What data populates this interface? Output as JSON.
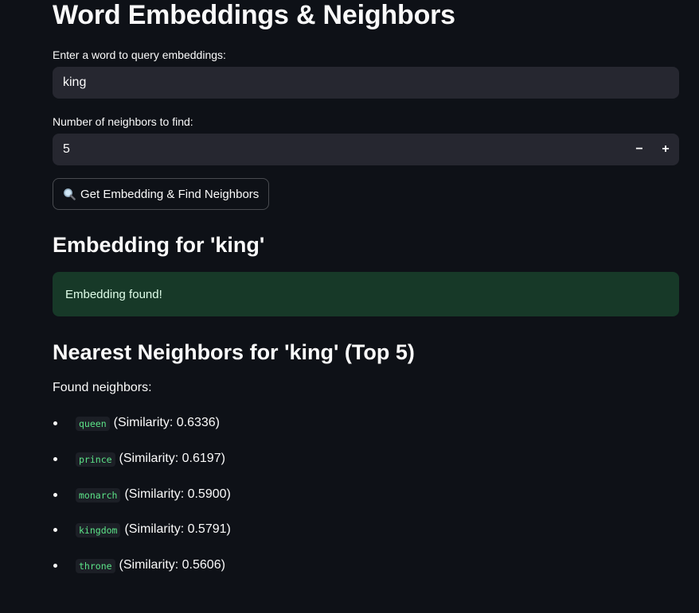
{
  "page": {
    "title": "Word Embeddings & Neighbors"
  },
  "word_query": {
    "label": "Enter a word to query embeddings:",
    "value": "king"
  },
  "neighbors_count": {
    "label": "Number of neighbors to find:",
    "value": "5",
    "minus": "−",
    "plus": "+"
  },
  "action_button": {
    "icon": "search-icon",
    "label": "Get Embedding & Find Neighbors"
  },
  "embedding_section": {
    "heading": "Embedding for 'king'",
    "status": "Embedding found!",
    "status_color": "#173928"
  },
  "neighbors_section": {
    "heading": "Nearest Neighbors for 'king' (Top 5)",
    "found_label": "Found neighbors:",
    "items": [
      {
        "word": "queen",
        "similarity": "(Similarity: 0.6336)"
      },
      {
        "word": "prince",
        "similarity": "(Similarity: 0.6197)"
      },
      {
        "word": "monarch",
        "similarity": "(Similarity: 0.5900)"
      },
      {
        "word": "kingdom",
        "similarity": "(Similarity: 0.5791)"
      },
      {
        "word": "throne",
        "similarity": "(Similarity: 0.5606)"
      }
    ]
  },
  "colors": {
    "background": "#0e1117",
    "input_bg": "#262730",
    "code_text": "#5ce488"
  }
}
